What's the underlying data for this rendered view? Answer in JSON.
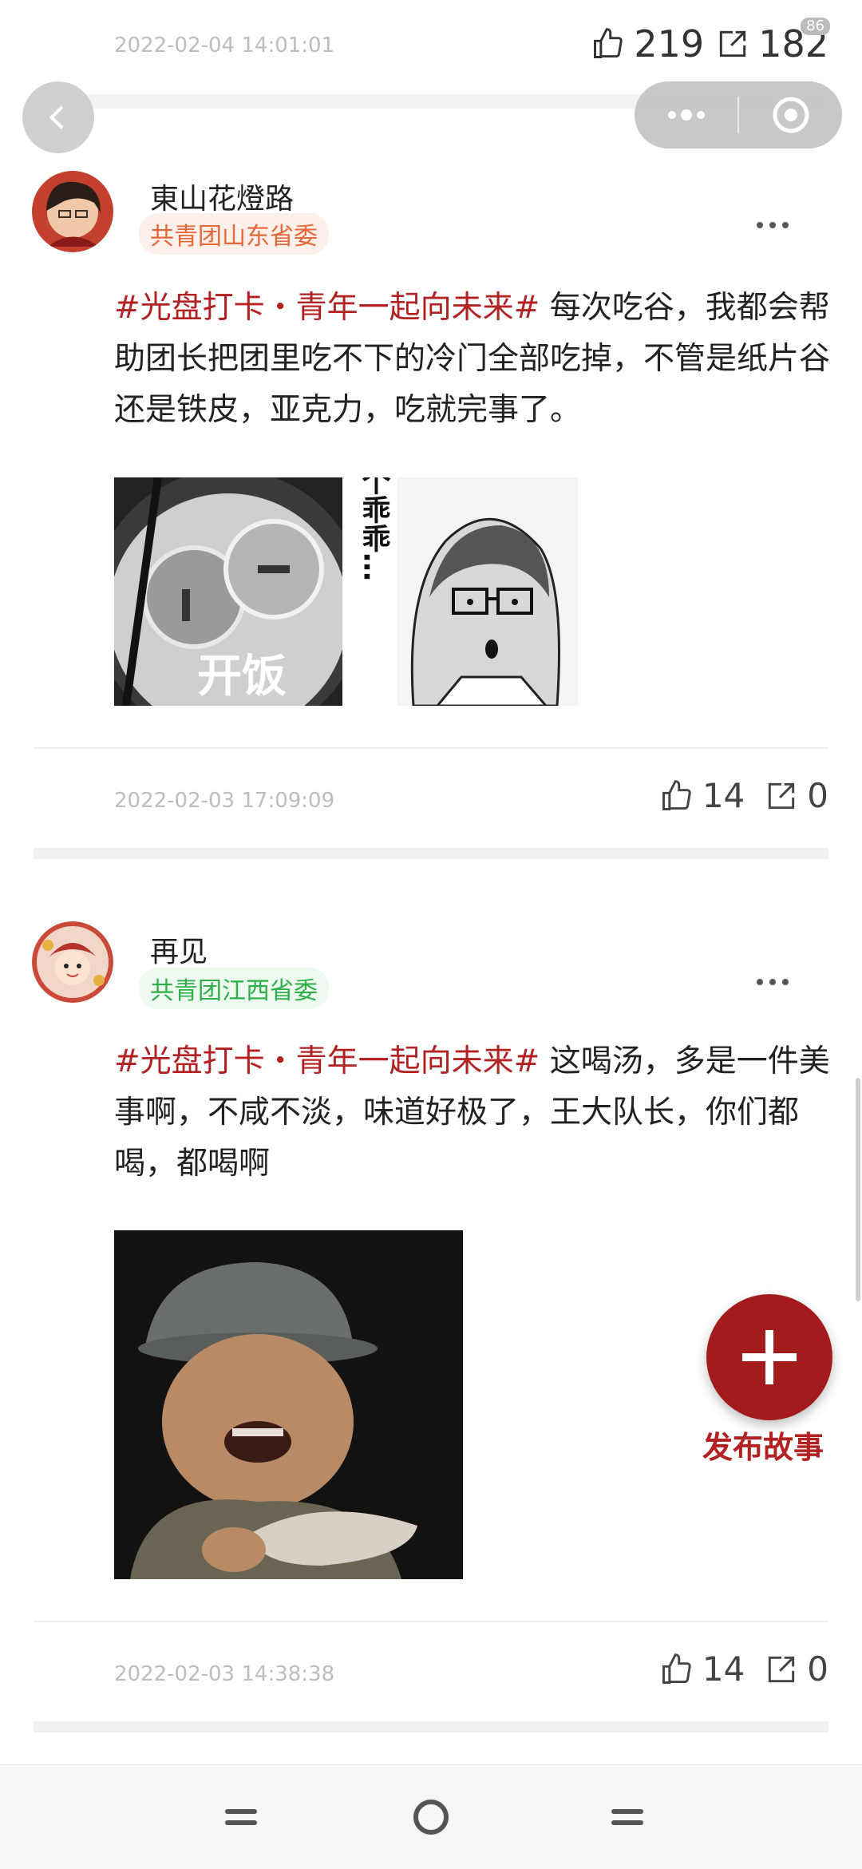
{
  "top_post": {
    "date": "2022-02-04 14:01:01",
    "likes": "219",
    "shares": "182",
    "badge": "86"
  },
  "posts": [
    {
      "username": "東山花燈路",
      "org": "共青团山东省委",
      "hashtag": "#光盘打卡・青年一起向未来#",
      "text": " 每次吃谷，我都会帮助团长把团里吃不下的冷门全部吃掉，不管是纸片谷还是铁皮，亚克力，吃就完事了。",
      "image1_caption": "开饭",
      "image2_caption": "滴个乖乖…",
      "date": "2022-02-03 17:09:09",
      "likes": "14",
      "shares": "0"
    },
    {
      "username": "再见",
      "org": "共青团江西省委",
      "hashtag": "#光盘打卡・青年一起向未来#",
      "text": " 这喝汤，多是一件美事啊，不咸不淡，味道好极了，王大队长，你们都喝，都喝啊",
      "date": "2022-02-03 14:38:38",
      "likes": "14",
      "shares": "0"
    }
  ],
  "fab": {
    "label": "发布故事"
  },
  "colors": {
    "accent": "#a31c1c",
    "hashtag": "#b22222"
  },
  "icons": [
    "thumb-up-icon",
    "share-icon",
    "back-icon",
    "more-dots-icon",
    "record-icon",
    "plus-icon"
  ]
}
